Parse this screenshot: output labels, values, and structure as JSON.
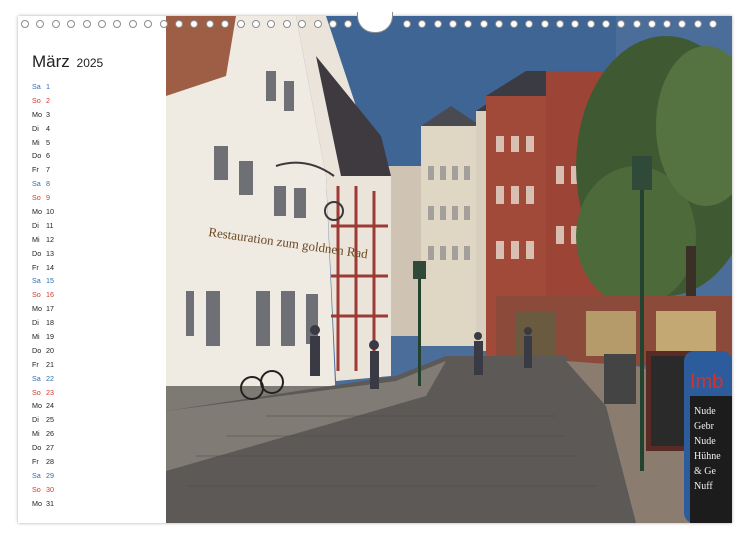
{
  "calendar": {
    "month": "März",
    "year": "2025",
    "days": [
      {
        "dn": "Sa",
        "num": "1",
        "type": "sat"
      },
      {
        "dn": "So",
        "num": "2",
        "type": "sun"
      },
      {
        "dn": "Mo",
        "num": "3",
        "type": ""
      },
      {
        "dn": "Di",
        "num": "4",
        "type": ""
      },
      {
        "dn": "Mi",
        "num": "5",
        "type": ""
      },
      {
        "dn": "Do",
        "num": "6",
        "type": ""
      },
      {
        "dn": "Fr",
        "num": "7",
        "type": ""
      },
      {
        "dn": "Sa",
        "num": "8",
        "type": "sat"
      },
      {
        "dn": "So",
        "num": "9",
        "type": "sun"
      },
      {
        "dn": "Mo",
        "num": "10",
        "type": ""
      },
      {
        "dn": "Di",
        "num": "11",
        "type": ""
      },
      {
        "dn": "Mi",
        "num": "12",
        "type": ""
      },
      {
        "dn": "Do",
        "num": "13",
        "type": ""
      },
      {
        "dn": "Fr",
        "num": "14",
        "type": ""
      },
      {
        "dn": "Sa",
        "num": "15",
        "type": "sat"
      },
      {
        "dn": "So",
        "num": "16",
        "type": "sun"
      },
      {
        "dn": "Mo",
        "num": "17",
        "type": ""
      },
      {
        "dn": "Di",
        "num": "18",
        "type": ""
      },
      {
        "dn": "Mi",
        "num": "19",
        "type": ""
      },
      {
        "dn": "Do",
        "num": "20",
        "type": ""
      },
      {
        "dn": "Fr",
        "num": "21",
        "type": ""
      },
      {
        "dn": "Sa",
        "num": "22",
        "type": "sat"
      },
      {
        "dn": "So",
        "num": "23",
        "type": "sun"
      },
      {
        "dn": "Mo",
        "num": "24",
        "type": ""
      },
      {
        "dn": "Di",
        "num": "25",
        "type": ""
      },
      {
        "dn": "Mi",
        "num": "26",
        "type": ""
      },
      {
        "dn": "Do",
        "num": "27",
        "type": ""
      },
      {
        "dn": "Fr",
        "num": "28",
        "type": ""
      },
      {
        "dn": "Sa",
        "num": "29",
        "type": "sat"
      },
      {
        "dn": "So",
        "num": "30",
        "type": "sun"
      },
      {
        "dn": "Mo",
        "num": "31",
        "type": ""
      }
    ]
  },
  "photo": {
    "restaurant_sign": "Restauration zum goldnen Rad",
    "imbiss_sign": "Imb",
    "board_lines": [
      "Nude",
      "Gebr",
      "Nude",
      "Hühne",
      "& Ge",
      "Nuff"
    ]
  },
  "colors": {
    "saturday": "#2f6fb3",
    "sunday": "#d23a2e"
  }
}
